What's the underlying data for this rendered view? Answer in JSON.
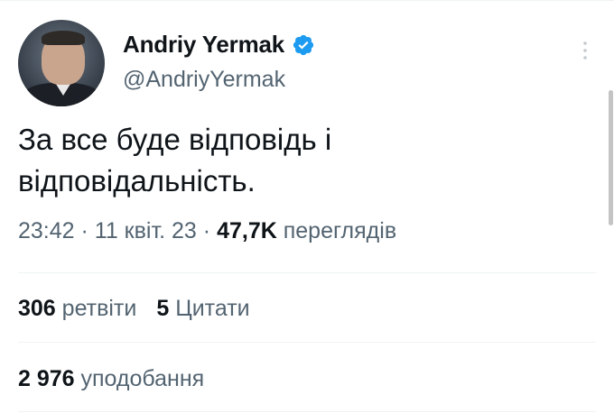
{
  "tweet": {
    "author": {
      "display_name": "Andriy Yermak",
      "handle": "@AndriyYermak",
      "verified": true
    },
    "text_lines": [
      "За все буде відповідь і",
      "відповідальність."
    ],
    "meta": {
      "time": "23:42",
      "separator": " · ",
      "date": "11 квіт. 23",
      "views_count": "47,7K",
      "views_label": "переглядів"
    },
    "stats": {
      "retweets_count": "306",
      "retweets_label": "ретвіти",
      "quotes_count": "5",
      "quotes_label": "Цитати",
      "likes_count": "2 976",
      "likes_label": "уподобання"
    }
  },
  "colors": {
    "text": "#0f1419",
    "secondary": "#536471",
    "verified_blue": "#1d9bf0",
    "divider": "#eff3f4"
  },
  "icons": {
    "verified": "verified-badge-icon",
    "more": "more-vertical-icon"
  }
}
